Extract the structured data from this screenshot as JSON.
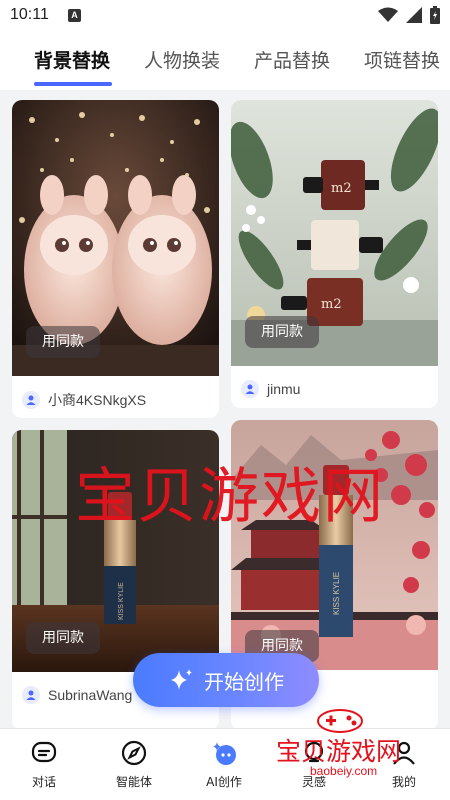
{
  "status_bar": {
    "time": "10:11",
    "notification_letter": "A"
  },
  "tabs": [
    {
      "label": "背景替换",
      "active": true
    },
    {
      "label": "人物换装",
      "active": false
    },
    {
      "label": "产品替换",
      "active": false
    },
    {
      "label": "项链替换",
      "active": false
    }
  ],
  "cards": [
    {
      "use_label": "用同款",
      "author": "小商4KSNkgXS"
    },
    {
      "use_label": "用同款",
      "author": "jinmu"
    },
    {
      "use_label": "用同款",
      "author": "SubrinaWang"
    },
    {
      "use_label": "用同款",
      "author": ""
    }
  ],
  "product_text": {
    "bottle_brand": "m2",
    "lipstick_brand": "KISS KYLIE"
  },
  "start_button": {
    "label": "开始创作"
  },
  "bottom_nav": [
    {
      "label": "对话",
      "icon": "chat-icon"
    },
    {
      "label": "智能体",
      "icon": "compass-icon"
    },
    {
      "label": "AI创作",
      "icon": "ai-create-icon"
    },
    {
      "label": "灵感",
      "icon": "bulb-icon"
    },
    {
      "label": "我的",
      "icon": "profile-icon"
    }
  ],
  "watermark": {
    "text": "宝贝游戏网",
    "logo_text": "宝贝游戏网",
    "logo_url": "baobeiy.com"
  },
  "colors": {
    "accent": "#4a67ff",
    "watermark": "#e3121c"
  }
}
